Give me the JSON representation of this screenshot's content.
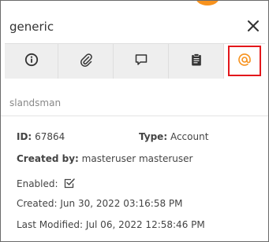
{
  "header": {
    "title": "generic"
  },
  "tabs": [
    {
      "icon": "info-icon"
    },
    {
      "icon": "paperclip-icon"
    },
    {
      "icon": "comment-icon"
    },
    {
      "icon": "clipboard-icon"
    },
    {
      "icon": "at-sign-icon"
    }
  ],
  "subheader": {
    "name": "slandsman"
  },
  "details": {
    "id_label": "ID:",
    "id_value": "67864",
    "type_label": "Type:",
    "type_value": "Account",
    "created_by_label": "Created by:",
    "created_by_value": "masteruser masteruser",
    "enabled_label": "Enabled:",
    "created_label": "Created:",
    "created_value": "Jun 30, 2022 03:16:58 PM",
    "modified_label": "Last Modified:",
    "modified_value": "Jul 06, 2022 12:58:46 PM"
  },
  "colors": {
    "accent": "#f7921e",
    "highlight_border": "#e3171b",
    "tab_bg": "#eeeeee"
  }
}
